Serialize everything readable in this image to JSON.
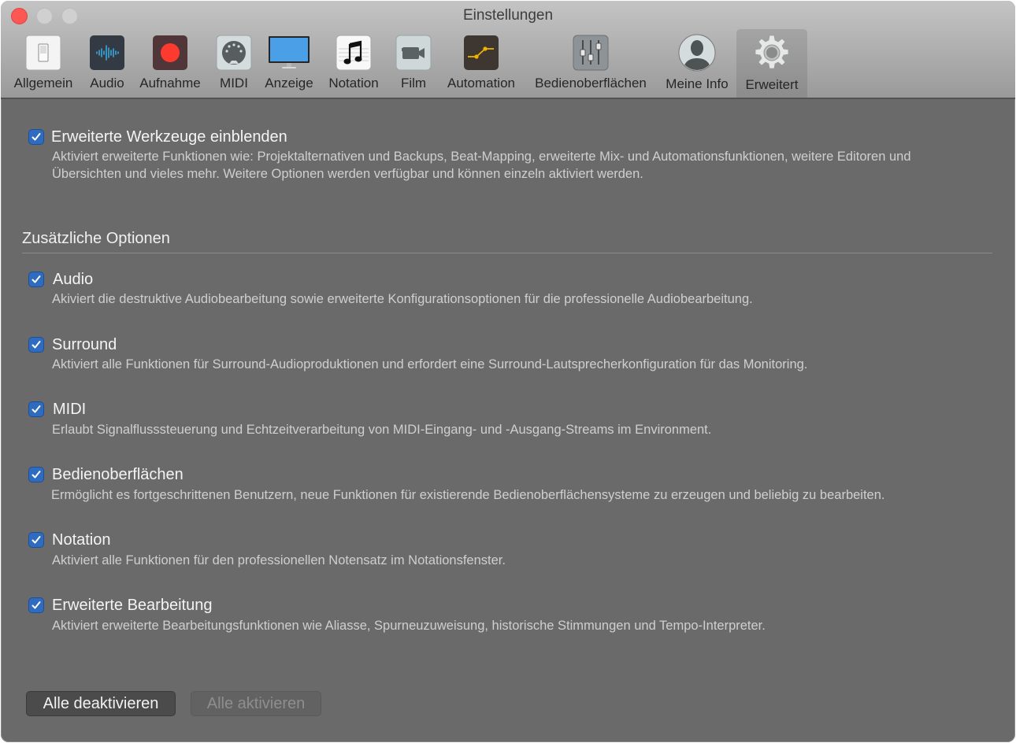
{
  "window": {
    "title": "Einstellungen"
  },
  "toolbar": {
    "items": [
      {
        "label": "Allgemein",
        "icon": "switch-icon"
      },
      {
        "label": "Audio",
        "icon": "waveform-icon"
      },
      {
        "label": "Aufnahme",
        "icon": "record-icon"
      },
      {
        "label": "MIDI",
        "icon": "midi-connector-icon"
      },
      {
        "label": "Anzeige",
        "icon": "monitor-icon"
      },
      {
        "label": "Notation",
        "icon": "music-note-icon"
      },
      {
        "label": "Film",
        "icon": "video-camera-icon"
      },
      {
        "label": "Automation",
        "icon": "automation-curve-icon"
      },
      {
        "label": "Bedienoberflächen",
        "icon": "faders-icon"
      },
      {
        "label": "Meine Info",
        "icon": "user-silhouette-icon"
      },
      {
        "label": "Erweitert",
        "icon": "gear-icon"
      }
    ],
    "active": "Erweitert"
  },
  "main_option": {
    "label": "Erweiterte Werkzeuge einblenden",
    "checked": true,
    "description": "Aktiviert erweiterte Funktionen wie: Projektalternativen und Backups, Beat-Mapping, erweiterte Mix- und Automationsfunktionen, weitere Editoren und Übersichten und vieles mehr. Weitere Optionen werden verfügbar und können einzeln aktiviert werden."
  },
  "section": {
    "title": "Zusätzliche Optionen"
  },
  "options": [
    {
      "label": "Audio",
      "checked": true,
      "description": "Akiviert die destruktive Audiobearbeitung sowie erweiterte Konfigurationsoptionen für die professionelle Audiobearbeitung."
    },
    {
      "label": "Surround",
      "checked": true,
      "description": "Aktiviert alle Funktionen für Surround-Audioproduktionen und erfordert eine Surround-Lautsprecherkonfiguration für das Monitoring."
    },
    {
      "label": "MIDI",
      "checked": true,
      "description": "Erlaubt Signalflusssteuerung und Echtzeitverarbeitung von MIDI-Eingang- und -Ausgang-Streams im Environment."
    },
    {
      "label": "Bedienoberflächen",
      "checked": true,
      "description": "Ermöglicht es fortgeschrittenen Benutzern, neue Funktionen für existierende Bedienoberflächensysteme zu erzeugen und beliebig zu bearbeiten."
    },
    {
      "label": "Notation",
      "checked": true,
      "description": "Aktiviert alle Funktionen für den professionellen Notensatz im Notationsfenster."
    },
    {
      "label": "Erweiterte Bearbeitung",
      "checked": true,
      "description": "Aktiviert erweiterte Bearbeitungsfunktionen wie Aliasse, Spurneuzuweisung, historische Stimmungen und Tempo-Interpreter."
    }
  ],
  "buttons": {
    "deactivate_all": "Alle deaktivieren",
    "activate_all": "Alle aktivieren"
  },
  "colors": {
    "checkbox": "#2f6cc0",
    "record": "#fc3a30",
    "waveform": "#3aa8de",
    "automation": "#f0b400"
  }
}
